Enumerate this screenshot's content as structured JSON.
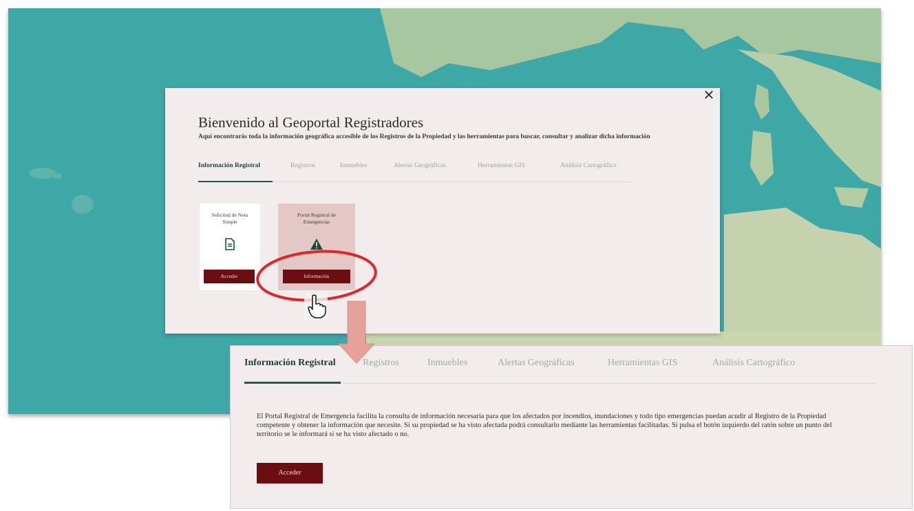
{
  "modal": {
    "title": "Bienvenido al Geoportal Registradores",
    "subtitle": "Aquí encontrarás toda la información geográfica accesible de los Registros de la Propiedad y las herramientas para buscar, consultar y analizar dicha información",
    "close_label": "✕",
    "tabs": [
      {
        "label": "Información Registral",
        "active": true
      },
      {
        "label": "Registros",
        "active": false
      },
      {
        "label": "Inmuebles",
        "active": false
      },
      {
        "label": "Alertas Geográficas",
        "active": false
      },
      {
        "label": "Herramientas GIS",
        "active": false
      },
      {
        "label": "Análisis Cartográfico",
        "active": false
      }
    ],
    "cards": [
      {
        "title": "Solicitud de Nota Simple",
        "icon": "document-icon",
        "button": "Acceder"
      },
      {
        "title": "Portal Registral de Emergencias",
        "icon": "warning-icon",
        "button": "Información"
      }
    ]
  },
  "detail": {
    "tabs": [
      {
        "label": "Información Registral",
        "active": true
      },
      {
        "label": "Registros",
        "active": false
      },
      {
        "label": "Inmuebles",
        "active": false
      },
      {
        "label": "Alertas Geográficas",
        "active": false
      },
      {
        "label": "Herramientas GIS",
        "active": false
      },
      {
        "label": "Análisis Cartográfico",
        "active": false
      }
    ],
    "description": "El Portal Registral de Emergencia facilita la consulta de información necesaria para que los afectados por incendios, inundaciones y todo tipo emergencias puedan acudir al Registro de la Propiedad competente y obtener la información que necesite. Si su propiedad se ha visto afectada podrá consultarlo mediante las herramientas facilitadas. Si pulsa el botón izquierdo del ratón sobre un punto del territorio se le informará si se ha visto afectado o no.",
    "button": "Acceder"
  },
  "colors": {
    "accent_dark_red": "#6a0e12",
    "tab_active": "#1e5a5a",
    "sea": "#3ea8a6",
    "annotation": "#e0262b"
  }
}
